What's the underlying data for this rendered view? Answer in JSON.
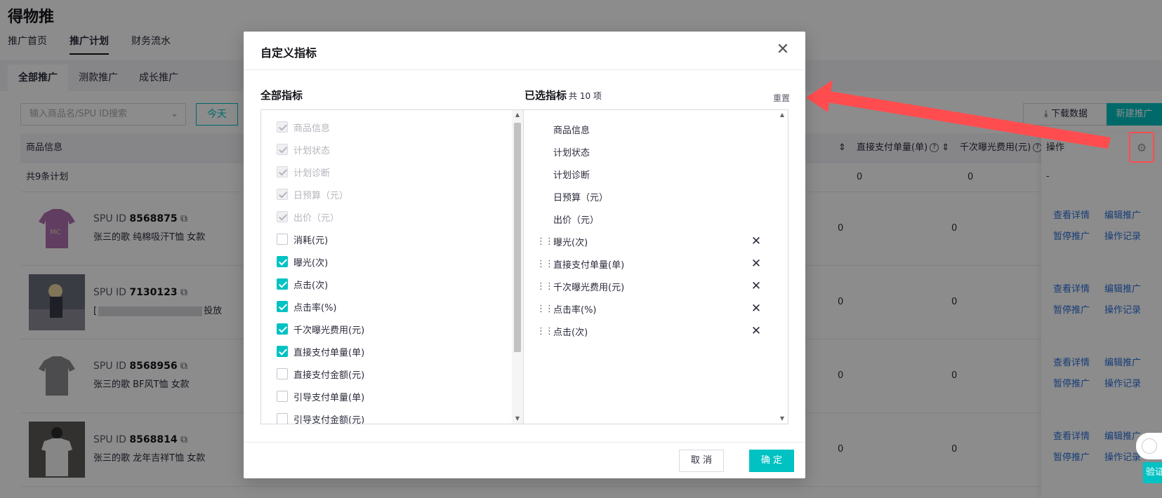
{
  "app": {
    "title": "得物推"
  },
  "top_nav": [
    {
      "label": "推广首页"
    },
    {
      "label": "推广计划"
    },
    {
      "label": "财务流水"
    }
  ],
  "sub_tabs": [
    {
      "label": "全部推广"
    },
    {
      "label": "测款推广"
    },
    {
      "label": "成长推广"
    }
  ],
  "toolbar": {
    "search_placeholder": "输入商品名/SPU ID搜索",
    "today_label": "今天",
    "download_label": "下载数据",
    "new_label": "新建推广"
  },
  "table": {
    "headers": {
      "product": "商品信息",
      "pay_orders": "直接支付单量(单)",
      "cpm": "千次曝光费用(元)",
      "ops": "操作"
    },
    "summary": {
      "label": "共9条计划",
      "v1": "0",
      "v2": "0",
      "ops": "-"
    },
    "rows": [
      {
        "spu_prefix": "SPU ID",
        "spu_id": "8568875",
        "name": "张三的歌 纯棉吸汗T恤 女款",
        "v1": "0",
        "v2": "0"
      },
      {
        "spu_prefix": "SPU ID",
        "spu_id": "7130123",
        "name": "[",
        "name_tail": "投放",
        "v1": "0",
        "v2": "0"
      },
      {
        "spu_prefix": "SPU ID",
        "spu_id": "8568956",
        "name": "张三的歌 BF风T恤 女款",
        "v1": "0",
        "v2": "0"
      },
      {
        "spu_prefix": "SPU ID",
        "spu_id": "8568814",
        "name": "张三的歌 龙年吉祥T恤 女款",
        "v1": "0",
        "v2": "0"
      }
    ],
    "ops_links": {
      "detail": "查看详情",
      "edit": "编辑推广",
      "pause": "暂停推广",
      "log": "操作记录"
    }
  },
  "float_widget": {
    "verify_label": "验证"
  },
  "modal": {
    "title": "自定义指标",
    "left_title": "全部指标",
    "right_title": "已选指标",
    "right_count": "共 10 项",
    "reset_label": "重置",
    "all_metrics": [
      {
        "label": "商品信息",
        "state": "fixed"
      },
      {
        "label": "计划状态",
        "state": "fixed"
      },
      {
        "label": "计划诊断",
        "state": "fixed"
      },
      {
        "label": "日预算（元）",
        "state": "fixed"
      },
      {
        "label": "出价（元）",
        "state": "fixed"
      },
      {
        "label": "消耗(元)",
        "state": "unchecked"
      },
      {
        "label": "曝光(次)",
        "state": "checked"
      },
      {
        "label": "点击(次)",
        "state": "checked"
      },
      {
        "label": "点击率(%)",
        "state": "checked"
      },
      {
        "label": "千次曝光费用(元)",
        "state": "checked"
      },
      {
        "label": "直接支付单量(单)",
        "state": "checked"
      },
      {
        "label": "直接支付金额(元)",
        "state": "unchecked"
      },
      {
        "label": "引导支付单量(单)",
        "state": "unchecked"
      },
      {
        "label": "引导支付金额(元)",
        "state": "unchecked"
      }
    ],
    "selected_fixed": [
      {
        "label": "商品信息"
      },
      {
        "label": "计划状态"
      },
      {
        "label": "计划诊断"
      },
      {
        "label": "日预算（元）"
      },
      {
        "label": "出价（元）"
      }
    ],
    "selected_custom": [
      {
        "label": "曝光(次)"
      },
      {
        "label": "直接支付单量(单)"
      },
      {
        "label": "千次曝光费用(元)"
      },
      {
        "label": "点击率(%)"
      },
      {
        "label": "点击(次)"
      }
    ],
    "cancel_label": "取 消",
    "ok_label": "确 定"
  },
  "colors": {
    "accent": "#01c2c3",
    "annotation": "#ff4d4f",
    "link": "#2b6fdb"
  },
  "icons": {
    "close": "close-icon",
    "gear": "gear-icon",
    "download": "download-icon",
    "drag": "drag-handle-icon",
    "remove": "remove-icon",
    "copy": "copy-icon"
  }
}
